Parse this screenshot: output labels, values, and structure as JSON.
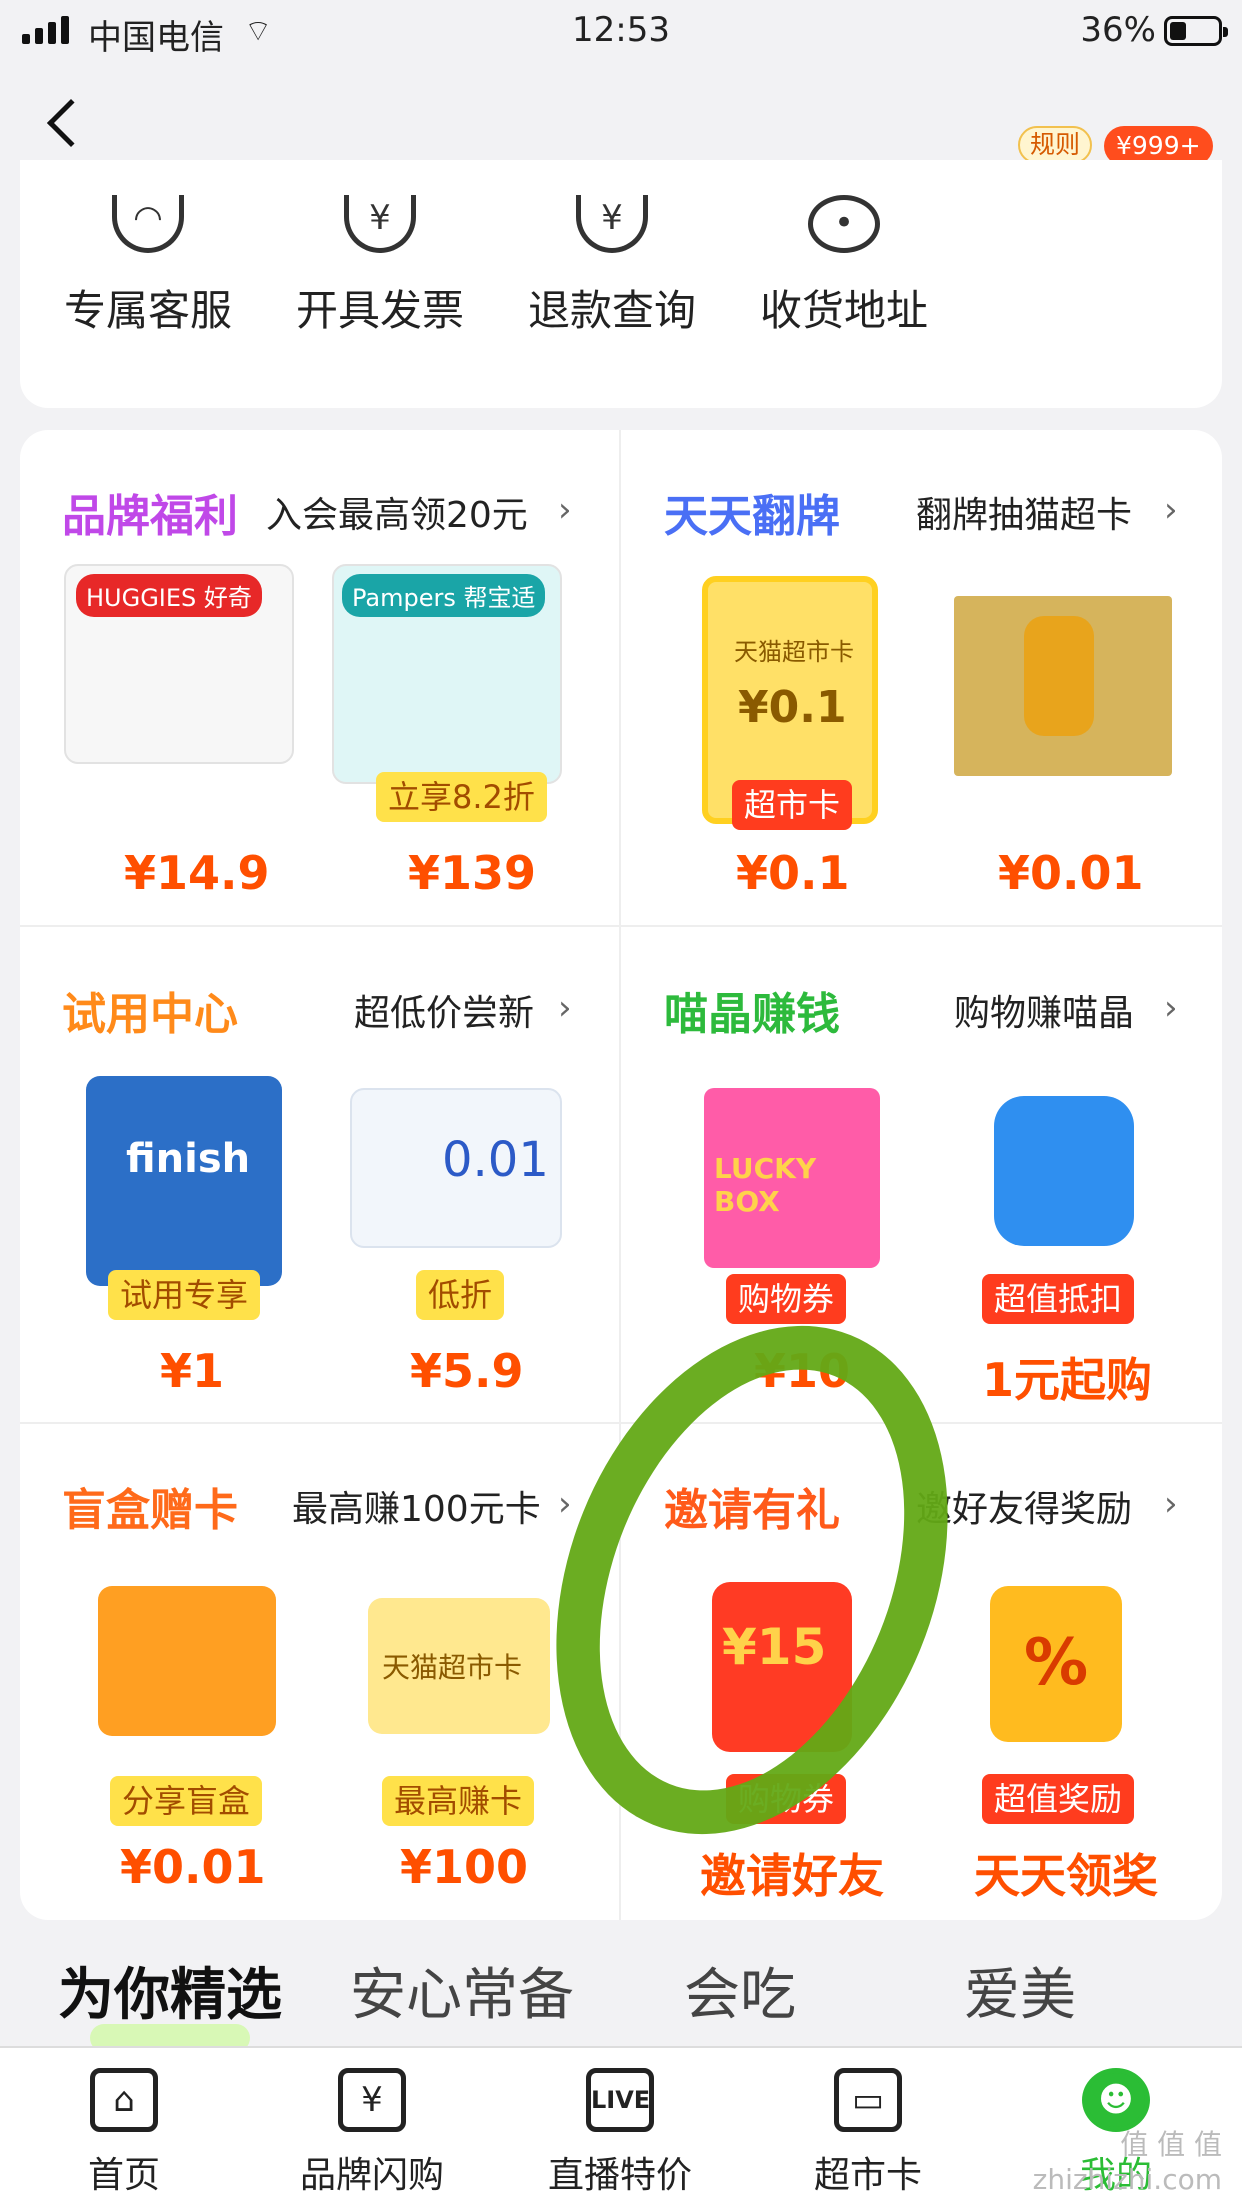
{
  "status": {
    "carrier": "中国电信",
    "time": "12:53",
    "battery": "36%"
  },
  "header": {
    "rule_badge": "规则",
    "cart_badge": "¥999+"
  },
  "services": [
    {
      "label": "专属客服"
    },
    {
      "label": "开具发票"
    },
    {
      "label": "退款查询"
    },
    {
      "label": "收货地址"
    }
  ],
  "grid": {
    "brand": {
      "title": "品牌福利",
      "subtitle": "入会最高领20元",
      "items": [
        {
          "brand": "HUGGIES 好奇",
          "price": "¥14.9"
        },
        {
          "brand": "Pampers 帮宝适",
          "tag": "立享8.2折",
          "price": "¥139"
        }
      ]
    },
    "flip": {
      "title": "天天翻牌",
      "subtitle": "翻牌抽猫超卡",
      "items": [
        {
          "card_title": "天猫超市卡",
          "card_value": "¥0.1",
          "tag": "超市卡",
          "price": "¥0.1"
        },
        {
          "price": "¥0.01"
        }
      ]
    },
    "trial": {
      "title": "试用中心",
      "subtitle": "超低价尝新",
      "items": [
        {
          "brand": "finish",
          "tag": "试用专享",
          "price": "¥1"
        },
        {
          "brand": "0.01",
          "tag": "低折",
          "price": "¥5.9"
        }
      ]
    },
    "crystal": {
      "title": "喵晶赚钱",
      "subtitle": "购物赚喵晶",
      "items": [
        {
          "brand": "LUCKY BOX",
          "tag": "购物券",
          "price": "¥10"
        },
        {
          "tag": "超值抵扣",
          "price": "1元起购"
        }
      ]
    },
    "blindbox": {
      "title": "盲盒赠卡",
      "subtitle": "最高赚100元卡",
      "items": [
        {
          "tag": "分享盲盒",
          "price": "¥0.01"
        },
        {
          "card_title": "天猫超市卡",
          "tag": "最高赚卡",
          "price": "¥100"
        }
      ]
    },
    "invite": {
      "title": "邀请有礼",
      "subtitle": "邀好友得奖励",
      "items": [
        {
          "card_value": "¥15",
          "tag": "购物券",
          "price": "邀请好友"
        },
        {
          "tag": "超值奖励",
          "price": "天天领奖"
        }
      ]
    }
  },
  "tabs": [
    "为你精选",
    "安心常备",
    "会吃",
    "爱美"
  ],
  "bottom_nav": [
    {
      "label": "首页"
    },
    {
      "label": "品牌闪购",
      "icon_text": "¥"
    },
    {
      "label": "直播特价",
      "icon_text": "LIVE"
    },
    {
      "label": "超市卡"
    },
    {
      "label": "我的"
    }
  ],
  "watermark": "值 值 值\nzhizhizhi.com"
}
